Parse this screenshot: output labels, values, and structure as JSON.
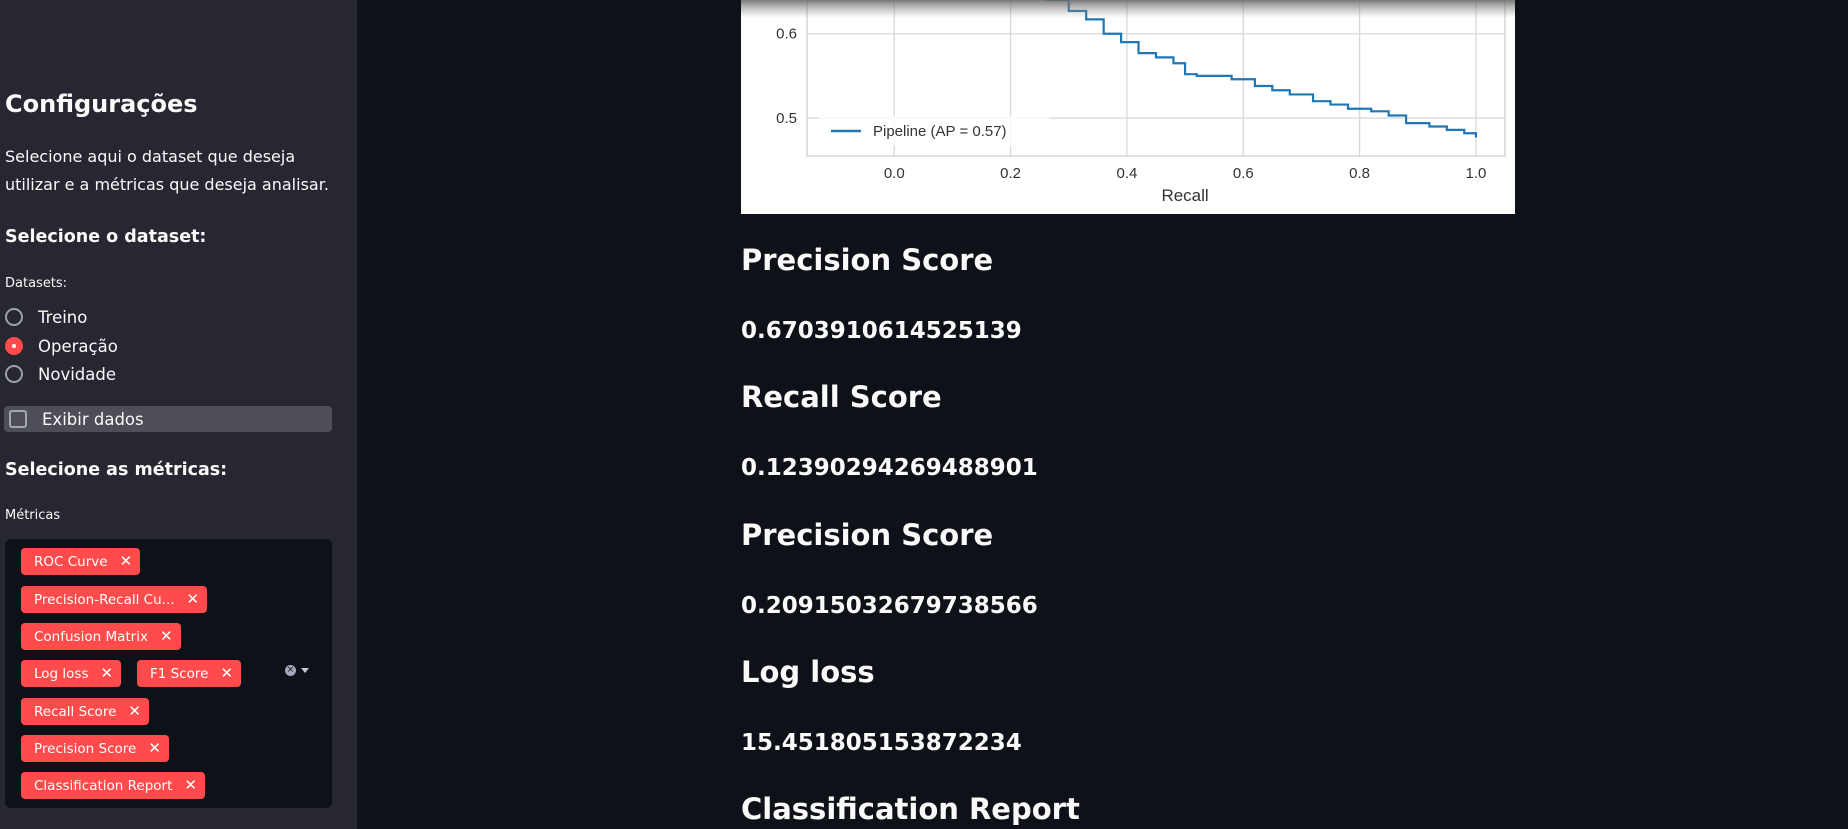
{
  "sidebar": {
    "title": "Configurações",
    "description": "Selecione aqui o dataset que deseja utilizar e a métricas que deseja analisar.",
    "dataset_heading": "Selecione o dataset:",
    "datasets_label": "Datasets:",
    "datasets": [
      {
        "label": "Treino",
        "selected": false
      },
      {
        "label": "Operação",
        "selected": true
      },
      {
        "label": "Novidade",
        "selected": false
      }
    ],
    "show_data_label": "Exibir dados",
    "show_data_checked": false,
    "metrics_heading": "Selecione as métricas:",
    "metrics_label": "Métricas",
    "selected_metrics": [
      "ROC Curve",
      "Precision-Recall Cu...",
      "Confusion Matrix",
      "Log loss",
      "F1 Score",
      "Recall Score",
      "Precision Score",
      "Classification Report"
    ],
    "tag_close_glyph": "✕"
  },
  "chart_data": {
    "type": "line",
    "xlabel": "Recall",
    "ylabel": "",
    "xlim": [
      -0.15,
      1.05
    ],
    "ylim": [
      0.455,
      0.64
    ],
    "x_ticks": [
      0.0,
      0.2,
      0.4,
      0.6,
      0.8,
      1.0
    ],
    "x_tick_labels": [
      "0.0",
      "0.2",
      "0.4",
      "0.6",
      "0.8",
      "1.0"
    ],
    "y_ticks": [
      0.5,
      0.6
    ],
    "y_tick_labels": [
      "0.5",
      "0.6"
    ],
    "grid": true,
    "legend_position": "lower-left",
    "series": [
      {
        "name": "Pipeline (AP = 0.57)",
        "color": "#1f77b4",
        "x": [
          0.26,
          0.3,
          0.33,
          0.36,
          0.39,
          0.42,
          0.45,
          0.48,
          0.5,
          0.52,
          0.55,
          0.58,
          0.62,
          0.65,
          0.68,
          0.72,
          0.75,
          0.78,
          0.82,
          0.85,
          0.88,
          0.92,
          0.95,
          0.98,
          1.0
        ],
        "y": [
          0.64,
          0.627,
          0.617,
          0.6,
          0.59,
          0.577,
          0.572,
          0.565,
          0.552,
          0.55,
          0.55,
          0.546,
          0.538,
          0.533,
          0.528,
          0.52,
          0.516,
          0.511,
          0.508,
          0.503,
          0.494,
          0.49,
          0.486,
          0.482,
          0.477
        ]
      }
    ]
  },
  "metrics": [
    {
      "title": "Precision Score",
      "value": "0.6703910614525139"
    },
    {
      "title": "Recall Score",
      "value": "0.12390294269488901"
    },
    {
      "title": "Precision Score",
      "value": "0.20915032679738566"
    },
    {
      "title": "Log loss",
      "value": "15.451805153872234"
    },
    {
      "title": "Classification Report",
      "value": ""
    }
  ]
}
